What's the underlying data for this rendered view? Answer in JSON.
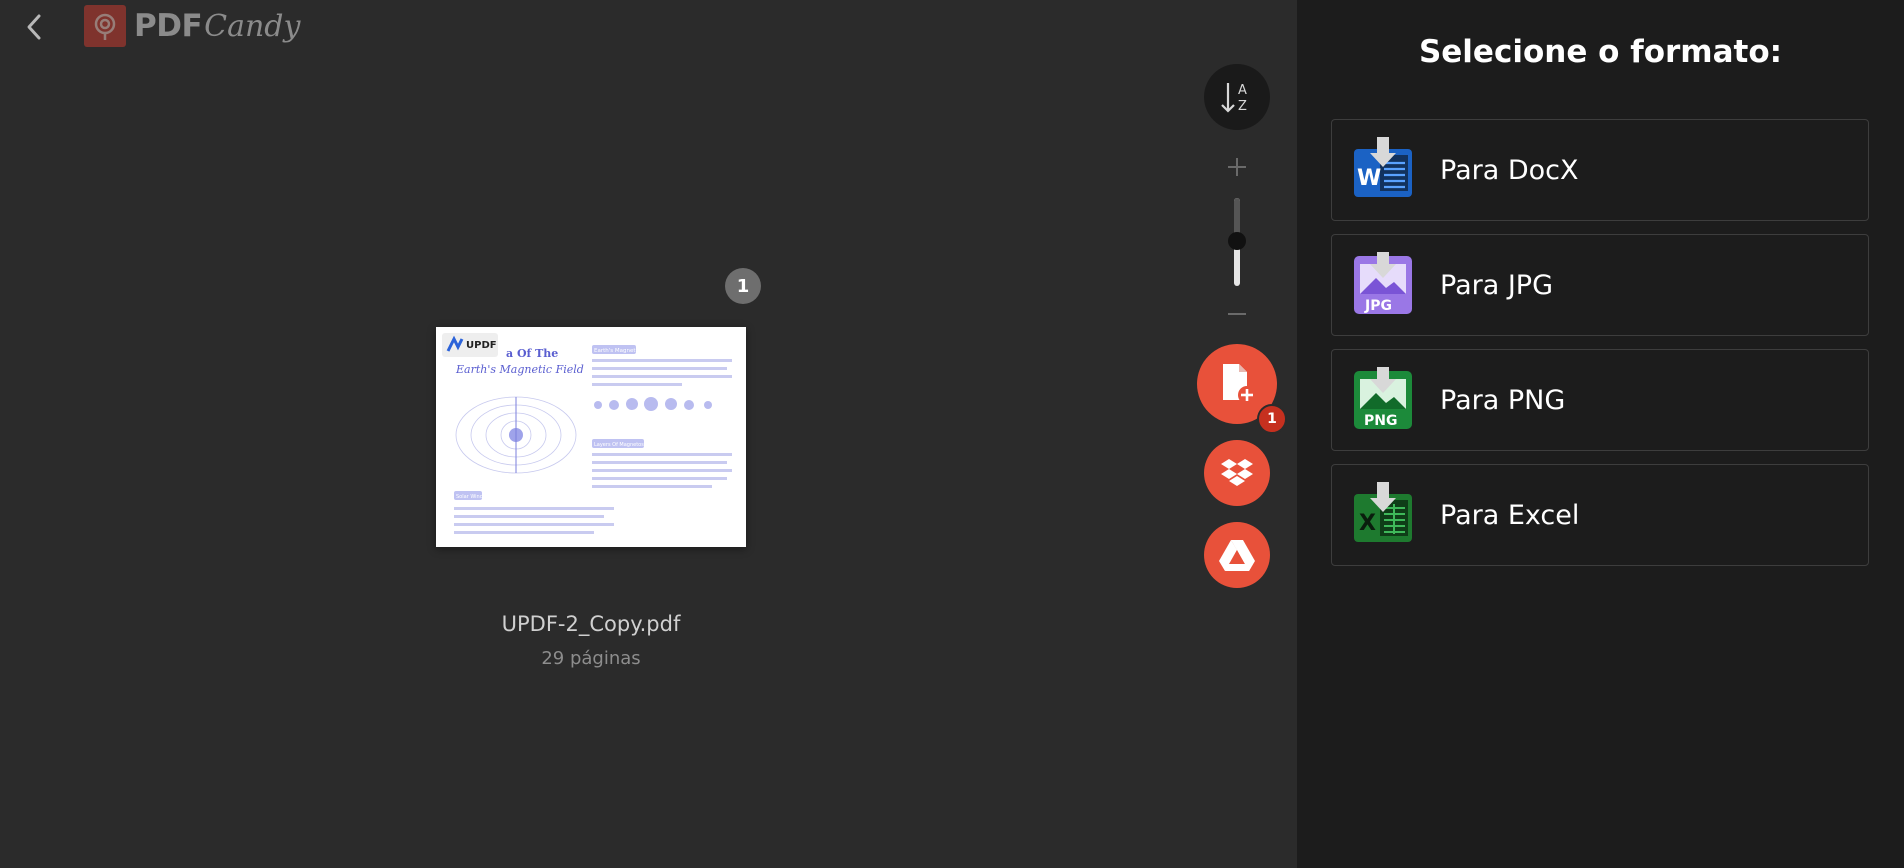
{
  "header": {
    "logo_pdf": "PDF",
    "logo_candy": "Candy"
  },
  "document": {
    "page_badge": "1",
    "file_name": "UPDF-2_Copy.pdf",
    "pages_label": "29 páginas",
    "thumbnail": {
      "brand": "UPDF",
      "title_line1": "a Of The",
      "title_line2": "Earth's Magnetic Field",
      "section1": "Earth's Magnetic",
      "section2": "Layers Of Magnetosphere",
      "section3": "Solar Wind"
    }
  },
  "toolbar": {
    "sort_letters": [
      "A",
      "Z"
    ],
    "add_file_count": "1"
  },
  "panel": {
    "title": "Selecione o formato:",
    "formats": [
      {
        "label": "Para DocX",
        "icon": "word-download-icon",
        "badge": "W"
      },
      {
        "label": "Para JPG",
        "icon": "jpg-download-icon",
        "badge": "JPG"
      },
      {
        "label": "Para PNG",
        "icon": "png-download-icon",
        "badge": "PNG"
      },
      {
        "label": "Para Excel",
        "icon": "excel-download-icon",
        "badge": "X"
      }
    ]
  },
  "colors": {
    "accent": "#e8513a",
    "word": "#1b62c4",
    "jpg": "#9a77e6",
    "png": "#1c8a3a",
    "excel": "#1e7a2f"
  }
}
